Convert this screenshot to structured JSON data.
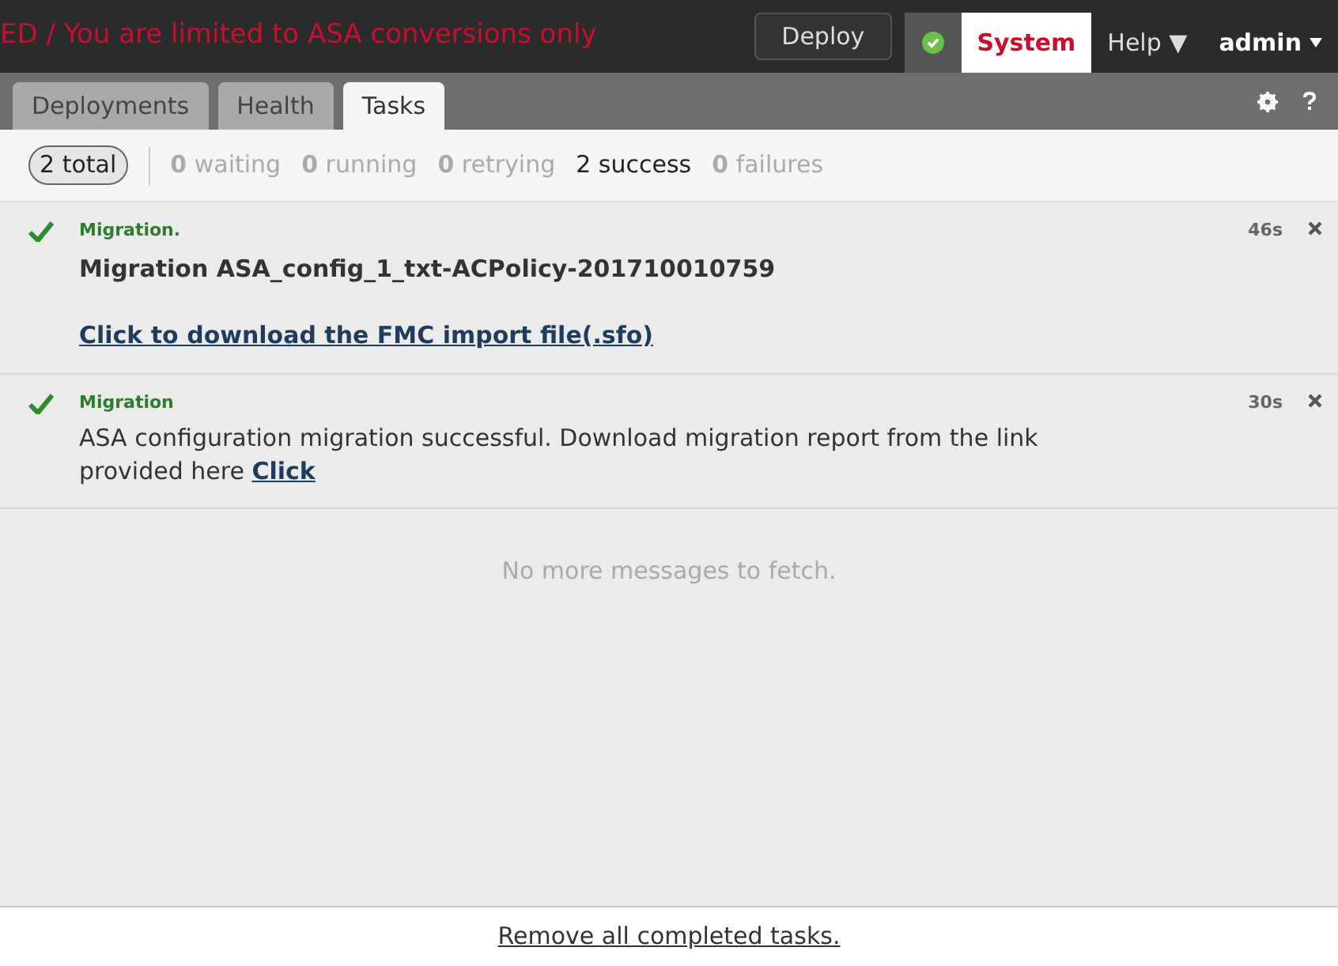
{
  "banner": {
    "text": "ED / You are limited to ASA conversions only"
  },
  "topnav": {
    "deploy": "Deploy",
    "status_ok": true,
    "items": [
      {
        "label": "System",
        "selected": true,
        "caret": false
      },
      {
        "label": "Help ▼",
        "selected": false,
        "caret": false
      },
      {
        "label": "admin",
        "selected": false,
        "caret": true
      }
    ]
  },
  "tabs": [
    {
      "label": "Deployments",
      "selected": false
    },
    {
      "label": "Health",
      "selected": false
    },
    {
      "label": "Tasks",
      "selected": true
    }
  ],
  "filters": [
    {
      "count": "2",
      "label": "total",
      "selected": true,
      "dimmed": false
    },
    {
      "count": "0",
      "label": "waiting",
      "selected": false,
      "dimmed": true
    },
    {
      "count": "0",
      "label": "running",
      "selected": false,
      "dimmed": true
    },
    {
      "count": "0",
      "label": "retrying",
      "selected": false,
      "dimmed": true
    },
    {
      "count": "2",
      "label": "success",
      "selected": false,
      "dimmed": false
    },
    {
      "count": "0",
      "label": "failures",
      "selected": false,
      "dimmed": true
    }
  ],
  "tasks": [
    {
      "kind": "download",
      "title": "Migration.",
      "time": "46s",
      "message": "Migration ASA_config_1_txt-ACPolicy-201710010759",
      "link": "Click to download the FMC import file(.sfo)"
    },
    {
      "kind": "report",
      "title": "Migration",
      "time": "30s",
      "message": "ASA configuration migration successful. Download migration report from the link provided here",
      "link": "Click"
    }
  ],
  "empty_message": "No more messages to fetch.",
  "footer_link": "Remove all completed tasks."
}
